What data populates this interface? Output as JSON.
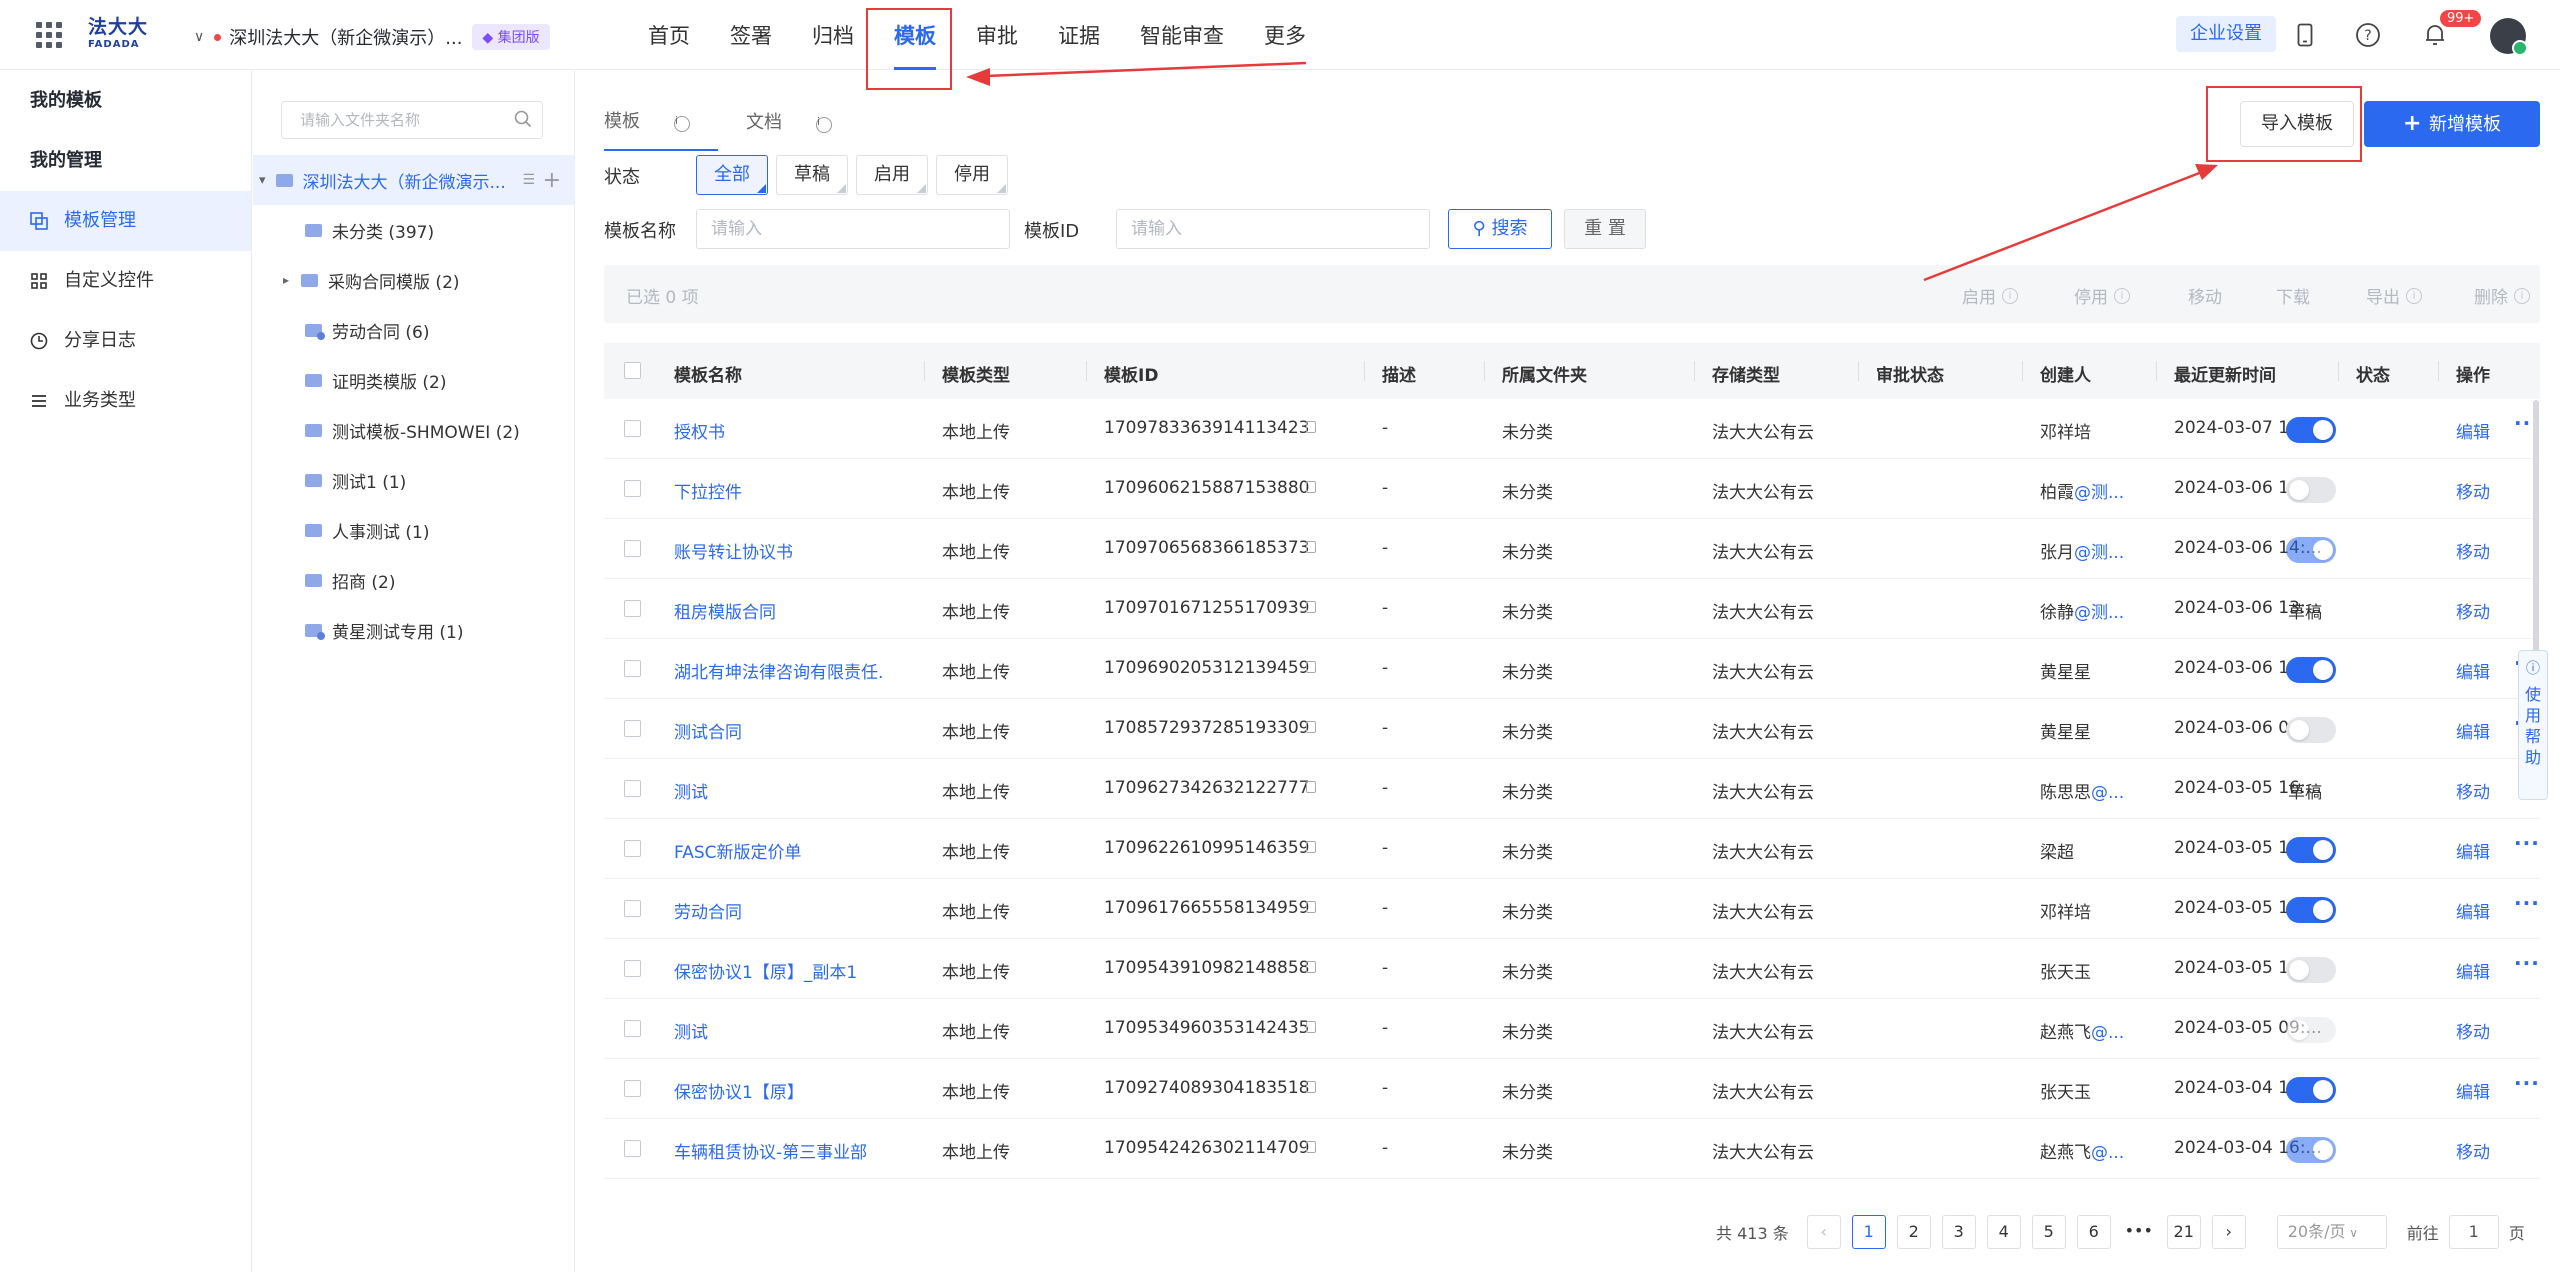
{
  "topbar": {
    "logo_cn": "法大大",
    "logo_en": "FADADA",
    "org_name": "深圳法大大（新企微演示）...",
    "org_badge": "集团版",
    "nav": [
      "首页",
      "签署",
      "归档",
      "模板",
      "审批",
      "证据",
      "智能审查",
      "更多"
    ],
    "active_nav": "模板",
    "enterprise_settings": "企业设置",
    "notification_count": "99+"
  },
  "leftnav": {
    "my_templates": "我的模板",
    "my_management": "我的管理",
    "items": [
      {
        "label": "模板管理",
        "icon": "template-manage-icon",
        "active": true
      },
      {
        "label": "自定义控件",
        "icon": "custom-control-icon",
        "active": false
      },
      {
        "label": "分享日志",
        "icon": "clock-icon",
        "active": false
      },
      {
        "label": "业务类型",
        "icon": "list-icon",
        "active": false
      }
    ]
  },
  "folders": {
    "search_placeholder": "请输入文件夹名称",
    "root": "深圳法大大（新企微演示...",
    "children": [
      {
        "label": "未分类 (397)",
        "expandable": false,
        "shared": false
      },
      {
        "label": "采购合同模版 (2)",
        "expandable": true,
        "shared": false
      },
      {
        "label": "劳动合同 (6)",
        "expandable": false,
        "shared": true
      },
      {
        "label": "证明类模版 (2)",
        "expandable": false,
        "shared": false
      },
      {
        "label": "测试模板-SHMOWEI (2)",
        "expandable": false,
        "shared": false
      },
      {
        "label": "测试1 (1)",
        "expandable": false,
        "shared": false
      },
      {
        "label": "人事测试 (1)",
        "expandable": false,
        "shared": false
      },
      {
        "label": "招商 (2)",
        "expandable": false,
        "shared": false
      },
      {
        "label": "黄星测试专用 (1)",
        "expandable": false,
        "shared": true
      }
    ]
  },
  "main": {
    "tabs": [
      "模板",
      "文档"
    ],
    "import_button": "导入模板",
    "add_button": "新增模板",
    "status_label": "状态",
    "status_chips": [
      "全部",
      "草稿",
      "启用",
      "停用"
    ],
    "name_label": "模板名称",
    "name_placeholder": "请输入",
    "id_label": "模板ID",
    "id_placeholder": "请输入",
    "search_button": "搜索",
    "reset_button": "重 置",
    "selected_text": "已选  0  项",
    "bulk_actions": [
      "启用",
      "停用",
      "移动",
      "下载",
      "导出",
      "删除"
    ],
    "columns": [
      "模板名称",
      "模板类型",
      "模板ID",
      "描述",
      "所属文件夹",
      "存储类型",
      "审批状态",
      "创建人",
      "最近更新时间",
      "状态",
      "操作"
    ],
    "rows": [
      {
        "name": "授权书",
        "type": "本地上传",
        "id": "1709783363914113423",
        "desc": "-",
        "folder": "未分类",
        "storage": "法大大公有云",
        "creator": "邓祥培",
        "updated": "2024-03-07 11:...",
        "state": "on",
        "actions": [
          "编辑"
        ],
        "more": true
      },
      {
        "name": "下拉控件",
        "type": "本地上传",
        "id": "1709606215887153880",
        "desc": "-",
        "folder": "未分类",
        "storage": "法大大公有云",
        "creator": "柏霞@测...",
        "updated": "2024-03-06 14:...",
        "state": "off",
        "actions": [
          "移动"
        ],
        "more": false
      },
      {
        "name": "账号转让协议书",
        "type": "本地上传",
        "id": "1709706568366185373",
        "desc": "-",
        "folder": "未分类",
        "storage": "法大大公有云",
        "creator": "张月@测...",
        "updated": "2024-03-06 14:...",
        "state": "on-dis",
        "actions": [
          "移动"
        ],
        "more": false
      },
      {
        "name": "租房模版合同",
        "type": "本地上传",
        "id": "1709701671255170939",
        "desc": "-",
        "folder": "未分类",
        "storage": "法大大公有云",
        "creator": "徐静@测...",
        "updated": "2024-03-06 13:...",
        "state": "草稿",
        "actions": [
          "移动"
        ],
        "more": false
      },
      {
        "name": "湖北有坤法律咨询有限责任...",
        "type": "本地上传",
        "id": "1709690205312139459",
        "desc": "-",
        "folder": "未分类",
        "storage": "法大大公有云",
        "creator": "黄星星",
        "updated": "2024-03-06 10:...",
        "state": "on",
        "actions": [
          "编辑"
        ],
        "more": true
      },
      {
        "name": "测试合同",
        "type": "本地上传",
        "id": "1708572937285193309",
        "desc": "-",
        "folder": "未分类",
        "storage": "法大大公有云",
        "creator": "黄星星",
        "updated": "2024-03-06 09:...",
        "state": "off",
        "actions": [
          "编辑"
        ],
        "more": true
      },
      {
        "name": "测试",
        "type": "本地上传",
        "id": "1709627342632122777",
        "desc": "-",
        "folder": "未分类",
        "storage": "法大大公有云",
        "creator": "陈思思@...",
        "updated": "2024-03-05 16:...",
        "state": "草稿",
        "actions": [
          "移动"
        ],
        "more": false
      },
      {
        "name": "FASC新版定价单",
        "type": "本地上传",
        "id": "1709622610995146359",
        "desc": "-",
        "folder": "未分类",
        "storage": "法大大公有云",
        "creator": "梁超",
        "updated": "2024-03-05 15:...",
        "state": "on",
        "actions": [
          "编辑"
        ],
        "more": true
      },
      {
        "name": "劳动合同",
        "type": "本地上传",
        "id": "1709617665558134959",
        "desc": "-",
        "folder": "未分类",
        "storage": "法大大公有云",
        "creator": "邓祥培",
        "updated": "2024-03-05 13:...",
        "state": "on",
        "actions": [
          "编辑"
        ],
        "more": true
      },
      {
        "name": "保密协议1【原】_副本1",
        "type": "本地上传",
        "id": "1709543910982148858",
        "desc": "-",
        "folder": "未分类",
        "storage": "法大大公有云",
        "creator": "张天玉",
        "updated": "2024-03-05 10:...",
        "state": "off",
        "actions": [
          "编辑"
        ],
        "more": true
      },
      {
        "name": "测试",
        "type": "本地上传",
        "id": "1709534960353142435",
        "desc": "-",
        "folder": "未分类",
        "storage": "法大大公有云",
        "creator": "赵燕飞@...",
        "updated": "2024-03-05 09:...",
        "state": "off-dis",
        "actions": [
          "移动"
        ],
        "more": false
      },
      {
        "name": "保密协议1【原】",
        "type": "本地上传",
        "id": "1709274089304183518",
        "desc": "-",
        "folder": "未分类",
        "storage": "法大大公有云",
        "creator": "张天玉",
        "updated": "2024-03-04 17:...",
        "state": "on",
        "actions": [
          "编辑"
        ],
        "more": true
      },
      {
        "name": "车辆租赁协议-第三事业部",
        "type": "本地上传",
        "id": "1709542426302114709",
        "desc": "-",
        "folder": "未分类",
        "storage": "法大大公有云",
        "creator": "赵燕飞@...",
        "updated": "2024-03-04 16:...",
        "state": "on-dis",
        "actions": [
          "移动"
        ],
        "more": false
      }
    ],
    "pagination": {
      "total": "共 413 条",
      "pages": [
        "1",
        "2",
        "3",
        "4",
        "5",
        "6",
        "•••",
        "21"
      ],
      "current": "1",
      "page_size": "20条/页",
      "goto_label": "前往",
      "goto_value": "1",
      "goto_suffix": "页"
    },
    "help_side": "使用帮助"
  },
  "colors": {
    "accent": "#2b6af0",
    "annotation": "#e63b3b"
  }
}
